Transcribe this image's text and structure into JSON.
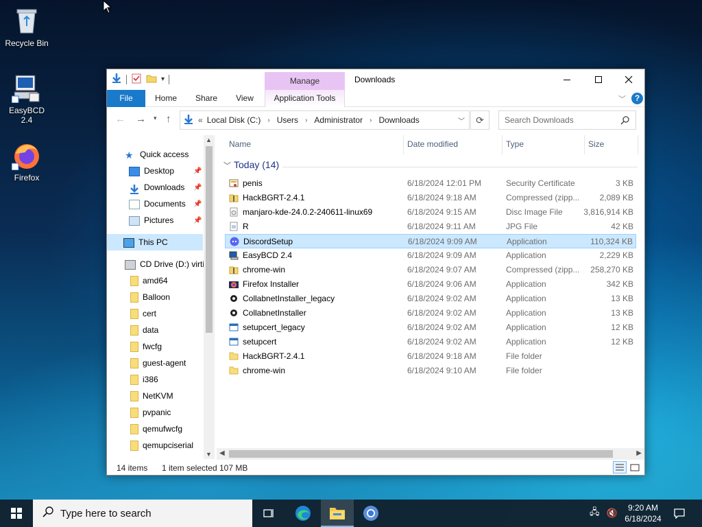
{
  "desktop": {
    "icons": [
      {
        "label": "Recycle Bin"
      },
      {
        "label": "EasyBCD 2.4"
      },
      {
        "label": "Firefox"
      }
    ]
  },
  "window": {
    "title": "Downloads",
    "manage_tab": "Manage",
    "ribbon_tabs": {
      "file": "File",
      "home": "Home",
      "share": "Share",
      "view": "View",
      "app_tools": "Application Tools"
    },
    "address": {
      "prefix": "«",
      "crumbs": [
        "Local Disk (C:)",
        "Users",
        "Administrator",
        "Downloads"
      ]
    },
    "search_placeholder": "Search Downloads",
    "nav": {
      "quick_access": "Quick access",
      "desktop": "Desktop",
      "downloads": "Downloads",
      "documents": "Documents",
      "pictures": "Pictures",
      "this_pc": "This PC",
      "cd_drive": "CD Drive (D:) virtio",
      "folders": [
        "amd64",
        "Balloon",
        "cert",
        "data",
        "fwcfg",
        "guest-agent",
        "i386",
        "NetKVM",
        "pvpanic",
        "qemufwcfg",
        "qemupciserial"
      ]
    },
    "columns": {
      "name": "Name",
      "date": "Date modified",
      "type": "Type",
      "size": "Size"
    },
    "group_label": "Today (14)",
    "files": [
      {
        "name": "penis",
        "date": "6/18/2024 12:01 PM",
        "type": "Security Certificate",
        "size": "3 KB",
        "icon": "certificate-icon"
      },
      {
        "name": "HackBGRT-2.4.1",
        "date": "6/18/2024 9:18 AM",
        "type": "Compressed (zipp...",
        "size": "2,089 KB",
        "icon": "zip-icon"
      },
      {
        "name": "manjaro-kde-24.0.2-240611-linux69",
        "date": "6/18/2024 9:15 AM",
        "type": "Disc Image File",
        "size": "3,816,914 KB",
        "icon": "disc-image-icon"
      },
      {
        "name": "R",
        "date": "6/18/2024 9:11 AM",
        "type": "JPG File",
        "size": "42 KB",
        "icon": "image-file-icon"
      },
      {
        "name": "DiscordSetup",
        "date": "6/18/2024 9:09 AM",
        "type": "Application",
        "size": "110,324 KB",
        "icon": "discord-icon",
        "selected": true
      },
      {
        "name": "EasyBCD 2.4",
        "date": "6/18/2024 9:09 AM",
        "type": "Application",
        "size": "2,229 KB",
        "icon": "easybcd-icon"
      },
      {
        "name": "chrome-win",
        "date": "6/18/2024 9:07 AM",
        "type": "Compressed (zipp...",
        "size": "258,270 KB",
        "icon": "zip-icon"
      },
      {
        "name": "Firefox Installer",
        "date": "6/18/2024 9:06 AM",
        "type": "Application",
        "size": "342 KB",
        "icon": "firefox-icon"
      },
      {
        "name": "CollabnetInstaller_legacy",
        "date": "6/18/2024 9:02 AM",
        "type": "Application",
        "size": "13 KB",
        "icon": "installer-icon"
      },
      {
        "name": "CollabnetInstaller",
        "date": "6/18/2024 9:02 AM",
        "type": "Application",
        "size": "13 KB",
        "icon": "installer-icon"
      },
      {
        "name": "setupcert_legacy",
        "date": "6/18/2024 9:02 AM",
        "type": "Application",
        "size": "12 KB",
        "icon": "app-window-icon"
      },
      {
        "name": "setupcert",
        "date": "6/18/2024 9:02 AM",
        "type": "Application",
        "size": "12 KB",
        "icon": "app-window-icon"
      },
      {
        "name": "HackBGRT-2.4.1",
        "date": "6/18/2024 9:18 AM",
        "type": "File folder",
        "size": "",
        "icon": "folder-icon"
      },
      {
        "name": "chrome-win",
        "date": "6/18/2024 9:10 AM",
        "type": "File folder",
        "size": "",
        "icon": "folder-icon"
      }
    ],
    "status": {
      "count": "14 items",
      "selected": "1 item selected",
      "size": "107 MB"
    }
  },
  "taskbar": {
    "search_placeholder": "Type here to search",
    "time": "9:20 AM",
    "date": "6/18/2024"
  },
  "colors": {
    "accent": "#1979ca",
    "selection": "#cce8ff",
    "manage_tab": "#e8c4f4",
    "group_header": "#1e3287"
  }
}
